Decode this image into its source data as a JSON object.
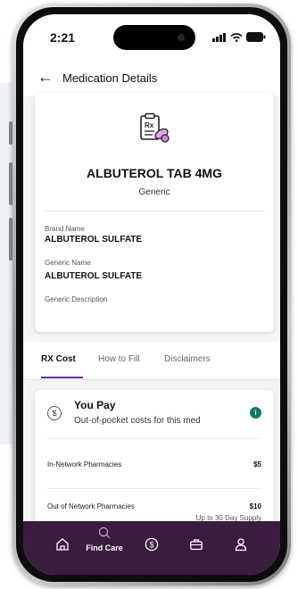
{
  "status_bar": {
    "time": "2:21"
  },
  "header": {
    "back_icon": "arrow-left-icon",
    "title": "Medication Details"
  },
  "medication": {
    "icon": "prescription-pills-icon",
    "name": "ALBUTEROL TAB 4MG",
    "type": "Generic",
    "fields": [
      {
        "label": "Brand Name",
        "value": "ALBUTEROL SULFATE"
      },
      {
        "label": "Generic Name",
        "value": "ALBUTEROL SULFATE"
      },
      {
        "label": "Generic Description",
        "value": ""
      }
    ]
  },
  "tabs": [
    {
      "label": "RX Cost",
      "active": true
    },
    {
      "label": "How to Fill",
      "active": false
    },
    {
      "label": "Disclaimers",
      "active": false
    }
  ],
  "cost_card": {
    "icon": "dollar-circle-icon",
    "title": "You Pay",
    "subtitle": "Out-of-pocket costs for this med",
    "info_icon": "info-icon",
    "rows": [
      {
        "label": "In-Network Pharmacies",
        "value": "$5",
        "note": ""
      },
      {
        "label": "Out of Network Pharmacies",
        "value": "$10",
        "note": "Up to 30 Day Supply"
      }
    ]
  },
  "bottom_nav": {
    "items": [
      {
        "icon": "home-icon",
        "label": ""
      },
      {
        "icon": "search-icon",
        "label": "Find Care"
      },
      {
        "icon": "dollar-circle-icon",
        "label": ""
      },
      {
        "icon": "briefcase-icon",
        "label": ""
      },
      {
        "icon": "user-icon",
        "label": ""
      }
    ]
  },
  "colors": {
    "accent": "#6b2f8e",
    "nav_bg": "#3a1c3f",
    "info": "#0e7a68"
  }
}
